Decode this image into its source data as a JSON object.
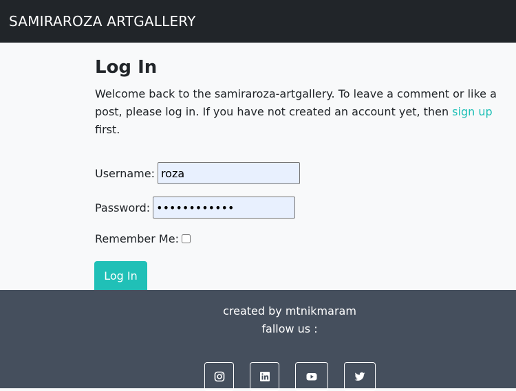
{
  "navbar": {
    "brand": "SAMIRAROZA ARTGALLERY"
  },
  "login": {
    "title": "Log In",
    "intro_text": "Welcome back to the samiraroza-artgallery. To leave a comment or like a post, please log in. If you have not created an account yet, then ",
    "signup_link": "sign up",
    "intro_suffix": " first.",
    "username_label": "Username:",
    "username_value": "roza",
    "password_label": "Password:",
    "password_value": "••••••••••••",
    "remember_label": "Remember Me:",
    "remember_checked": false,
    "submit_label": "Log In"
  },
  "footer": {
    "credit": "created by mtnikmaram",
    "follow": "fallow us :",
    "social": [
      {
        "icon": "instagram-icon"
      },
      {
        "icon": "linkedin-icon"
      },
      {
        "icon": "youtube-icon"
      },
      {
        "icon": "twitter-icon"
      }
    ]
  },
  "colors": {
    "navbar_bg": "#212529",
    "accent": "#20c0b7",
    "footer_bg": "#454f5d",
    "page_bg": "#f8f9fa",
    "input_autofill_bg": "#e8f0fe"
  }
}
